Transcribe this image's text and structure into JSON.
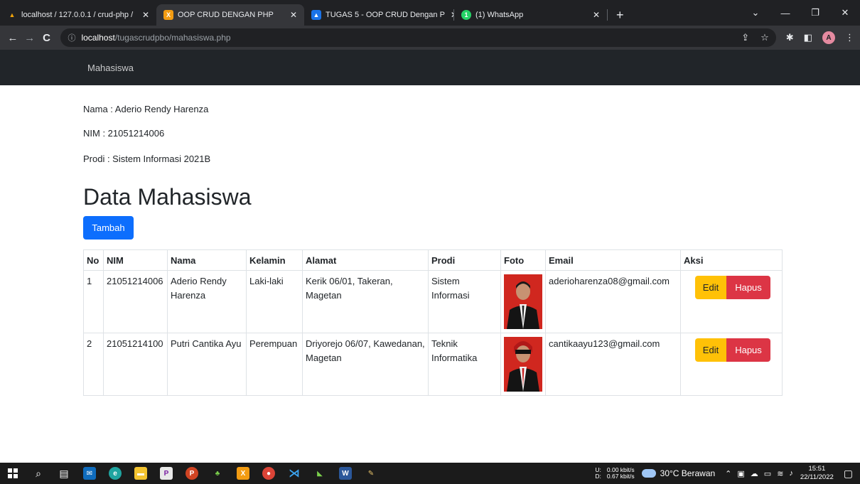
{
  "browser": {
    "tabs": [
      {
        "title": "localhost / 127.0.0.1 / crud-php /",
        "favicon_color": "#f0a30a",
        "favicon_glyph": "▲",
        "active": false
      },
      {
        "title": "OOP CRUD DENGAN PHP",
        "favicon_color": "#f39c12",
        "favicon_glyph": "X",
        "active": true
      },
      {
        "title": "TUGAS 5 - OOP CRUD Dengan P",
        "favicon_color": "#1a73e8",
        "favicon_glyph": "▲",
        "active": false
      },
      {
        "title": "(1) WhatsApp",
        "favicon_color": "#25d366",
        "favicon_glyph": "1",
        "active": false
      }
    ],
    "tab_close_glyph": "✕",
    "new_tab_glyph": "+",
    "window_controls": {
      "dropdown": "⌄",
      "minimize": "—",
      "restore": "❐",
      "close": "✕"
    },
    "nav": {
      "back": "←",
      "forward": "→",
      "reload": "C"
    },
    "url_info_glyph": "ⓘ",
    "url_host": "localhost",
    "url_path": "/tugascrudpbo/mahasiswa.php",
    "profile_initial": "A"
  },
  "navbar": {
    "brand": "Mahasiswa"
  },
  "student_info": {
    "nama": "Nama : Aderio Rendy Harenza",
    "nim": "NIM : 21051214006",
    "prodi": "Prodi : Sistem Informasi 2021B"
  },
  "page": {
    "title": "Data Mahasiswa",
    "add_button": "Tambah"
  },
  "table": {
    "headers": [
      "No",
      "NIM",
      "Nama",
      "Kelamin",
      "Alamat",
      "Prodi",
      "Foto",
      "Email",
      "Aksi"
    ],
    "rows": [
      {
        "no": "1",
        "nim": "21051214006",
        "nama": "Aderio Rendy Harenza",
        "kelamin": "Laki-laki",
        "alamat": "Kerik 06/01, Takeran, Magetan",
        "prodi": "Sistem Informasi",
        "photo_bg": "#d0271f",
        "email": "aderioharenza08@gmail.com",
        "edit": "Edit",
        "hapus": "Hapus"
      },
      {
        "no": "2",
        "nim": "21051214100",
        "nama": "Putri Cantika Ayu",
        "kelamin": "Perempuan",
        "alamat": "Driyorejo 06/07, Kawedanan, Magetan",
        "prodi": "Teknik Informatika",
        "photo_bg": "#d0271f",
        "email": "cantikaayu123@gmail.com",
        "edit": "Edit",
        "hapus": "Hapus"
      }
    ]
  },
  "taskbar": {
    "net_up_label": "U:",
    "net_down_label": "D:",
    "net_up": "0.00 kbit/s",
    "net_down": "0.67 kbit/s",
    "weather": "30°C Berawan",
    "time": "15:51",
    "date": "22/11/2022"
  }
}
